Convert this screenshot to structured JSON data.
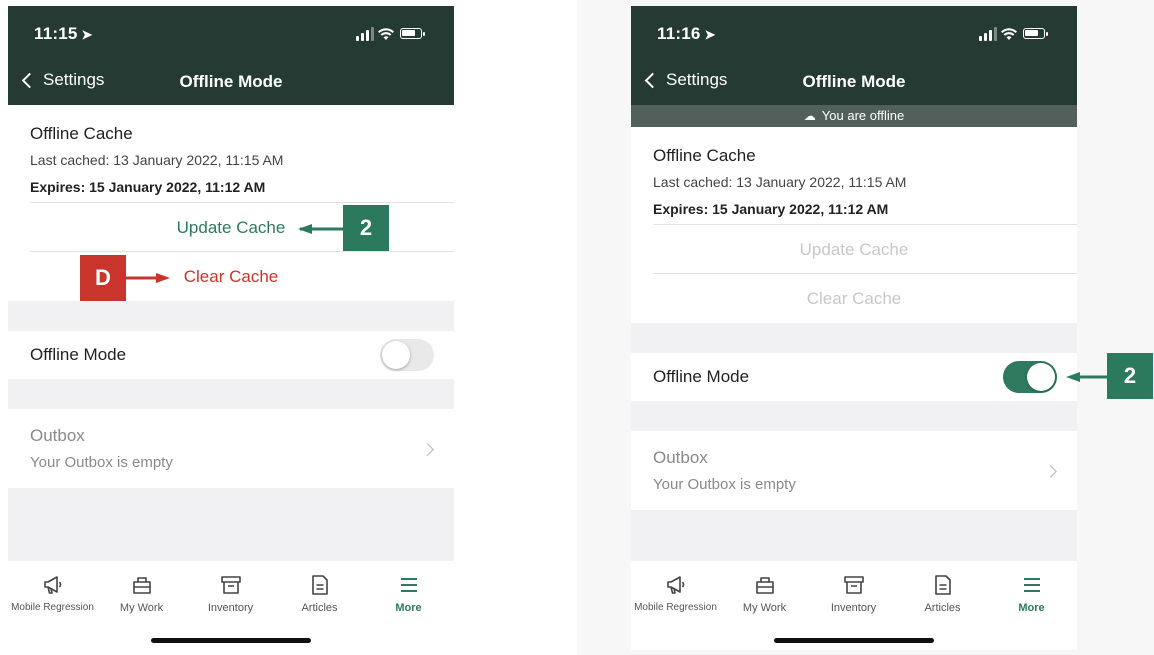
{
  "screen_a": {
    "time": "11:15",
    "nav_back": "Settings",
    "nav_title": "Offline Mode",
    "cache": {
      "title": "Offline Cache",
      "last_cached": "Last cached: 13 January 2022, 11:15 AM",
      "expires": "Expires: 15 January 2022, 11:12 AM",
      "update_label": "Update Cache",
      "clear_label": "Clear Cache"
    },
    "offline_mode": {
      "label": "Offline Mode",
      "on": false
    },
    "outbox": {
      "title": "Outbox",
      "subtitle": "Your Outbox is empty"
    },
    "callouts": {
      "update": "2",
      "clear": "D"
    }
  },
  "screen_b": {
    "time": "11:16",
    "nav_back": "Settings",
    "nav_title": "Offline Mode",
    "offline_banner": "You are offline",
    "cache": {
      "title": "Offline Cache",
      "last_cached": "Last cached: 13 January 2022, 11:15 AM",
      "expires": "Expires: 15 January 2022, 11:12 AM",
      "update_label": "Update Cache",
      "clear_label": "Clear Cache"
    },
    "offline_mode": {
      "label": "Offline Mode",
      "on": true
    },
    "outbox": {
      "title": "Outbox",
      "subtitle": "Your Outbox is empty"
    },
    "callouts": {
      "toggle": "2"
    }
  },
  "tabbar": {
    "items": [
      {
        "label": "Mobile Regression",
        "icon": "megaphone-icon"
      },
      {
        "label": "My Work",
        "icon": "briefcase-icon"
      },
      {
        "label": "Inventory",
        "icon": "archive-box-icon"
      },
      {
        "label": "Articles",
        "icon": "document-icon"
      },
      {
        "label": "More",
        "icon": "menu-icon"
      }
    ],
    "active_index": 4
  },
  "colors": {
    "header_bg": "#263a34",
    "accent_green": "#2f7a5f",
    "destructive_red": "#c9342c",
    "disabled_text": "#c8c8c8",
    "offline_banner_bg": "#52605b"
  }
}
